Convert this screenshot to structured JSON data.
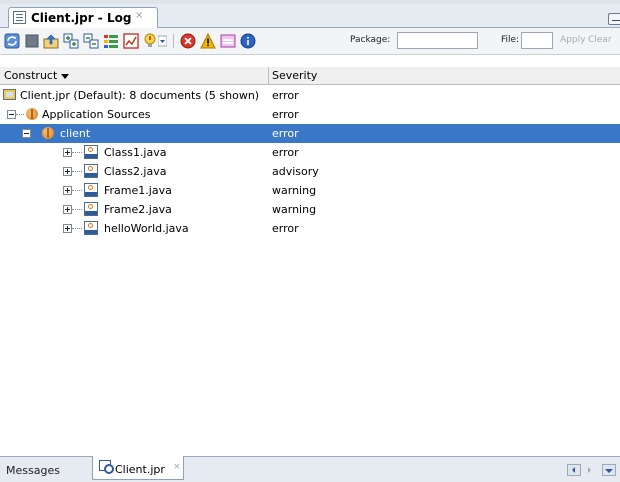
{
  "window": {
    "tab_title": "Client.jpr - Log",
    "tab_close": "×"
  },
  "toolbar": {
    "buttons": [
      {
        "icon": "refresh-audit-icon"
      },
      {
        "icon": "stop-icon"
      },
      {
        "icon": "export-icon"
      },
      {
        "icon": "expand-all-icon"
      },
      {
        "icon": "collapse-all-icon"
      },
      {
        "icon": "organize-icon"
      },
      {
        "icon": "chart-icon"
      },
      {
        "icon": "fix-dropdown-icon"
      },
      {
        "icon": "errors-filter-icon"
      },
      {
        "icon": "warnings-filter-icon"
      },
      {
        "icon": "incomplete-filter-icon"
      },
      {
        "icon": "info-filter-icon"
      }
    ],
    "package_label": "Package:",
    "package_value": "",
    "file_label": "File:",
    "file_value": "",
    "apply_label": "Apply",
    "clear_label": "Clear"
  },
  "table": {
    "columns": [
      "Construct",
      "Severity"
    ],
    "rows": [
      {
        "name": "Client.jpr (Default): 8 documents (5 shown)",
        "severity": "error",
        "level": 0,
        "icon": "project-icon",
        "expander": "none",
        "selected": false
      },
      {
        "name": "Application Sources",
        "severity": "error",
        "level": 1,
        "icon": "package-icon",
        "expander": "minus",
        "selected": false
      },
      {
        "name": "client",
        "severity": "error",
        "level": 2,
        "icon": "package-icon",
        "expander": "minus",
        "selected": true
      },
      {
        "name": "Class1.java",
        "severity": "error",
        "level": 3,
        "icon": "java-file-icon",
        "expander": "plus",
        "selected": false
      },
      {
        "name": "Class2.java",
        "severity": "advisory",
        "level": 3,
        "icon": "java-file-icon",
        "expander": "plus",
        "selected": false
      },
      {
        "name": "Frame1.java",
        "severity": "warning",
        "level": 3,
        "icon": "java-file-icon",
        "expander": "plus",
        "selected": false
      },
      {
        "name": "Frame2.java",
        "severity": "warning",
        "level": 3,
        "icon": "java-file-icon",
        "expander": "plus",
        "selected": false
      },
      {
        "name": "helloWorld.java",
        "severity": "error",
        "level": 3,
        "icon": "java-file-icon",
        "expander": "plus",
        "selected": false
      }
    ]
  },
  "bottom_tabs": {
    "messages": "Messages",
    "active": "Client.jpr",
    "active_close": "×"
  },
  "colors": {
    "selection": "#3a78c7",
    "error": "#d9362b",
    "warning": "#f2b705",
    "info": "#2b66c4"
  }
}
